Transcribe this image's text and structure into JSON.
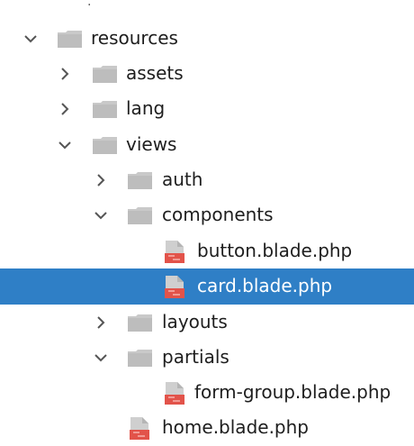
{
  "tree": {
    "top_mark": ".",
    "items": [
      {
        "label": "resources",
        "kind": "folder",
        "expanded": true
      },
      {
        "label": "assets",
        "kind": "folder",
        "expanded": false
      },
      {
        "label": "lang",
        "kind": "folder",
        "expanded": false
      },
      {
        "label": "views",
        "kind": "folder",
        "expanded": true
      },
      {
        "label": "auth",
        "kind": "folder",
        "expanded": false
      },
      {
        "label": "components",
        "kind": "folder",
        "expanded": true
      },
      {
        "label": "button.blade.php",
        "kind": "file"
      },
      {
        "label": "card.blade.php",
        "kind": "file",
        "selected": true
      },
      {
        "label": "layouts",
        "kind": "folder",
        "expanded": false
      },
      {
        "label": "partials",
        "kind": "folder",
        "expanded": true
      },
      {
        "label": "form-group.blade.php",
        "kind": "file"
      },
      {
        "label": "home.blade.php",
        "kind": "file"
      }
    ]
  },
  "colors": {
    "selection": "#2f7fc6",
    "folder": "#c9c9c9",
    "file_accent": "#e2534a"
  }
}
